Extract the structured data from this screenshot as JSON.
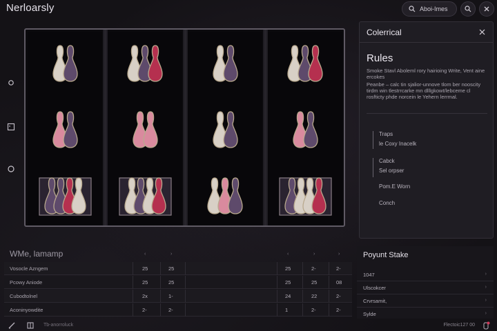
{
  "app": {
    "title": "Nerloarsly"
  },
  "header": {
    "search_label": "Aboi-Imes",
    "icons": [
      "search-icon",
      "search-icon",
      "close-icon"
    ]
  },
  "colors": {
    "cream": "#d8d0c6",
    "purple": "#5e4a6b",
    "crimson": "#b5304f",
    "pink": "#d98a9e",
    "bg": "#141216"
  },
  "side_icons": [
    "circle-icon",
    "square-icon",
    "ring-icon"
  ],
  "reels": [
    [
      [
        "cream",
        "purple"
      ],
      [
        "pink",
        "purple"
      ],
      [
        "purple",
        "purple",
        "crimson",
        "cream"
      ]
    ],
    [
      [
        "cream",
        "purple",
        "crimson"
      ],
      [
        "pink",
        "pink"
      ],
      [
        "cream",
        "purple",
        "cream",
        "crimson"
      ]
    ],
    [
      [
        "cream",
        "purple"
      ],
      [
        "cream",
        "purple"
      ],
      [
        "cream",
        "pink",
        "purple"
      ]
    ],
    [
      [
        "cream",
        "purple",
        "crimson"
      ],
      [
        "pink",
        "purple"
      ],
      [
        "purple",
        "cream",
        "cream",
        "crimson"
      ]
    ]
  ],
  "panel": {
    "title": "Colerrical",
    "rules_heading": "Rules",
    "rules_text_1": "Smoke Stavl Aboleml rory hairioing Write, Vent aine ercokes",
    "rules_text_2": "Peanbe – calc tin sjalior-unnove tlom ber nooscity tirdm win tlestrrcarke mn dlllgkowt/lebceme cl rosfticty phde norcein le Yehern lerrmal.",
    "links": [
      {
        "label": "Traps",
        "sub": "le Coxy Inacelk"
      },
      {
        "label": "Cabck",
        "sub": "Sel orpser"
      },
      {
        "label": "Pom.E Worn",
        "sub": ""
      },
      {
        "label": "Conch",
        "sub": ""
      }
    ]
  },
  "table": {
    "title": "WMe, lamamp",
    "header_arrows": [
      "‹",
      "›",
      "‹",
      "›",
      "‹",
      "›"
    ],
    "rows": [
      {
        "name": "Vosocle Azngem",
        "c1": "25",
        "c2": "25",
        "c3": "25",
        "c4": "2-",
        "c5": "2-"
      },
      {
        "name": "Pcowy Aniode",
        "c1": "25",
        "c2": "25",
        "c3": "25",
        "c4": "25",
        "c5": "08"
      },
      {
        "name": "Cubodtolnel",
        "c1": "2x",
        "c2": "1-",
        "c3": "24",
        "c4": "22",
        "c5": "2-"
      },
      {
        "name": "Aconinyowdite",
        "c1": "2-",
        "c2": "2-",
        "c3": "1",
        "c4": "2-",
        "c5": "2-"
      }
    ]
  },
  "stake": {
    "title": "Poyunt Stake",
    "rows": [
      "1047",
      "Ulscokcer",
      "Crvrsamit,",
      "Sylde"
    ]
  },
  "footer": {
    "left_text": "Tb-anorroluck",
    "right_text": "Flectoic127 00"
  }
}
